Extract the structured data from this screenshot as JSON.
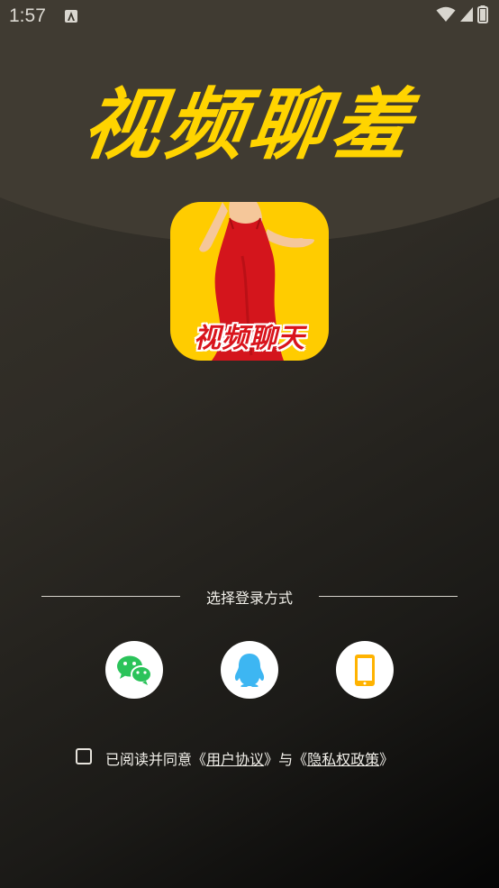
{
  "status_bar": {
    "time": "1:57",
    "icons": [
      "app-notification-icon",
      "wifi-icon",
      "signal-icon",
      "battery-icon"
    ]
  },
  "app_title": "视频聊羞",
  "logo": {
    "text": "视频聊天",
    "icon": "woman-in-red-dress-logo"
  },
  "login": {
    "divider_label": "选择登录方式",
    "methods": [
      {
        "name": "wechat",
        "icon": "wechat-icon"
      },
      {
        "name": "qq",
        "icon": "qq-icon"
      },
      {
        "name": "phone",
        "icon": "phone-icon"
      }
    ]
  },
  "agreement": {
    "checked": false,
    "prefix": "已阅读并同意",
    "open_bracket_1": "《",
    "user_agreement": "用户协议",
    "close_bracket_1": "》",
    "conjunction": "与",
    "open_bracket_2": "《",
    "privacy_policy": "隐私权政策",
    "close_bracket_2": "》"
  },
  "colors": {
    "title_yellow": "#ffd400",
    "logo_bg": "#ffcc00",
    "logo_text_red": "#d9141c",
    "wechat_green": "#2bc35a",
    "qq_blue": "#3db6f2",
    "phone_orange": "#ffb300"
  }
}
